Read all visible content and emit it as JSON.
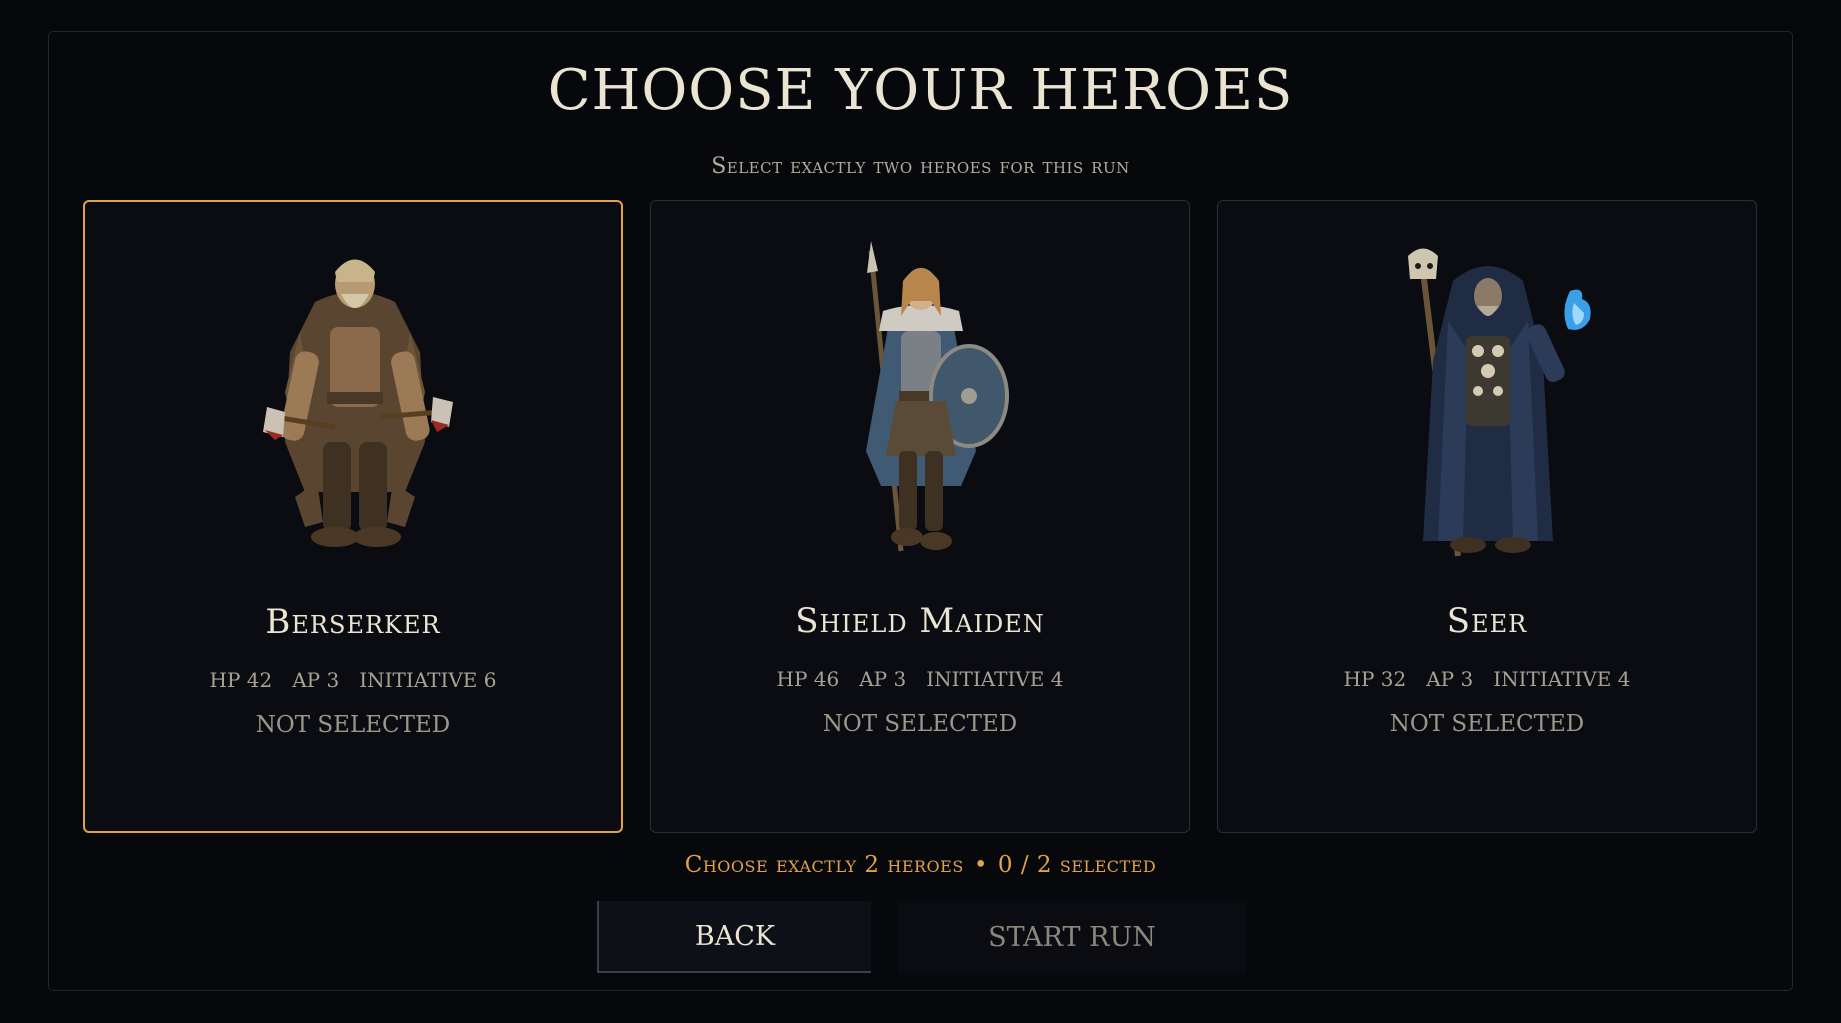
{
  "title": "CHOOSE YOUR HEROES",
  "subtitle": "Select exactly two heroes for this run",
  "heroes": [
    {
      "name": "Berserker",
      "hp": "HP 42",
      "ap": "AP 3",
      "initiative": "INITIATIVE 6",
      "status": "NOT SELECTED",
      "focused": true,
      "icon": "berserker-portrait"
    },
    {
      "name": "Shield Maiden",
      "hp": "HP 46",
      "ap": "AP 3",
      "initiative": "INITIATIVE 4",
      "status": "NOT SELECTED",
      "focused": false,
      "icon": "shield-maiden-portrait"
    },
    {
      "name": "Seer",
      "hp": "HP 32",
      "ap": "AP 3",
      "initiative": "INITIATIVE 4",
      "status": "NOT SELECTED",
      "focused": false,
      "icon": "seer-portrait"
    }
  ],
  "hint": {
    "text": "Choose exactly 2 heroes",
    "separator": "•",
    "count": "0 / 2 selected"
  },
  "buttons": {
    "back": "BACK",
    "start": "START RUN"
  },
  "colors": {
    "accent": "#e3a14a",
    "background": "#05070b",
    "card": "#0a0c11"
  }
}
